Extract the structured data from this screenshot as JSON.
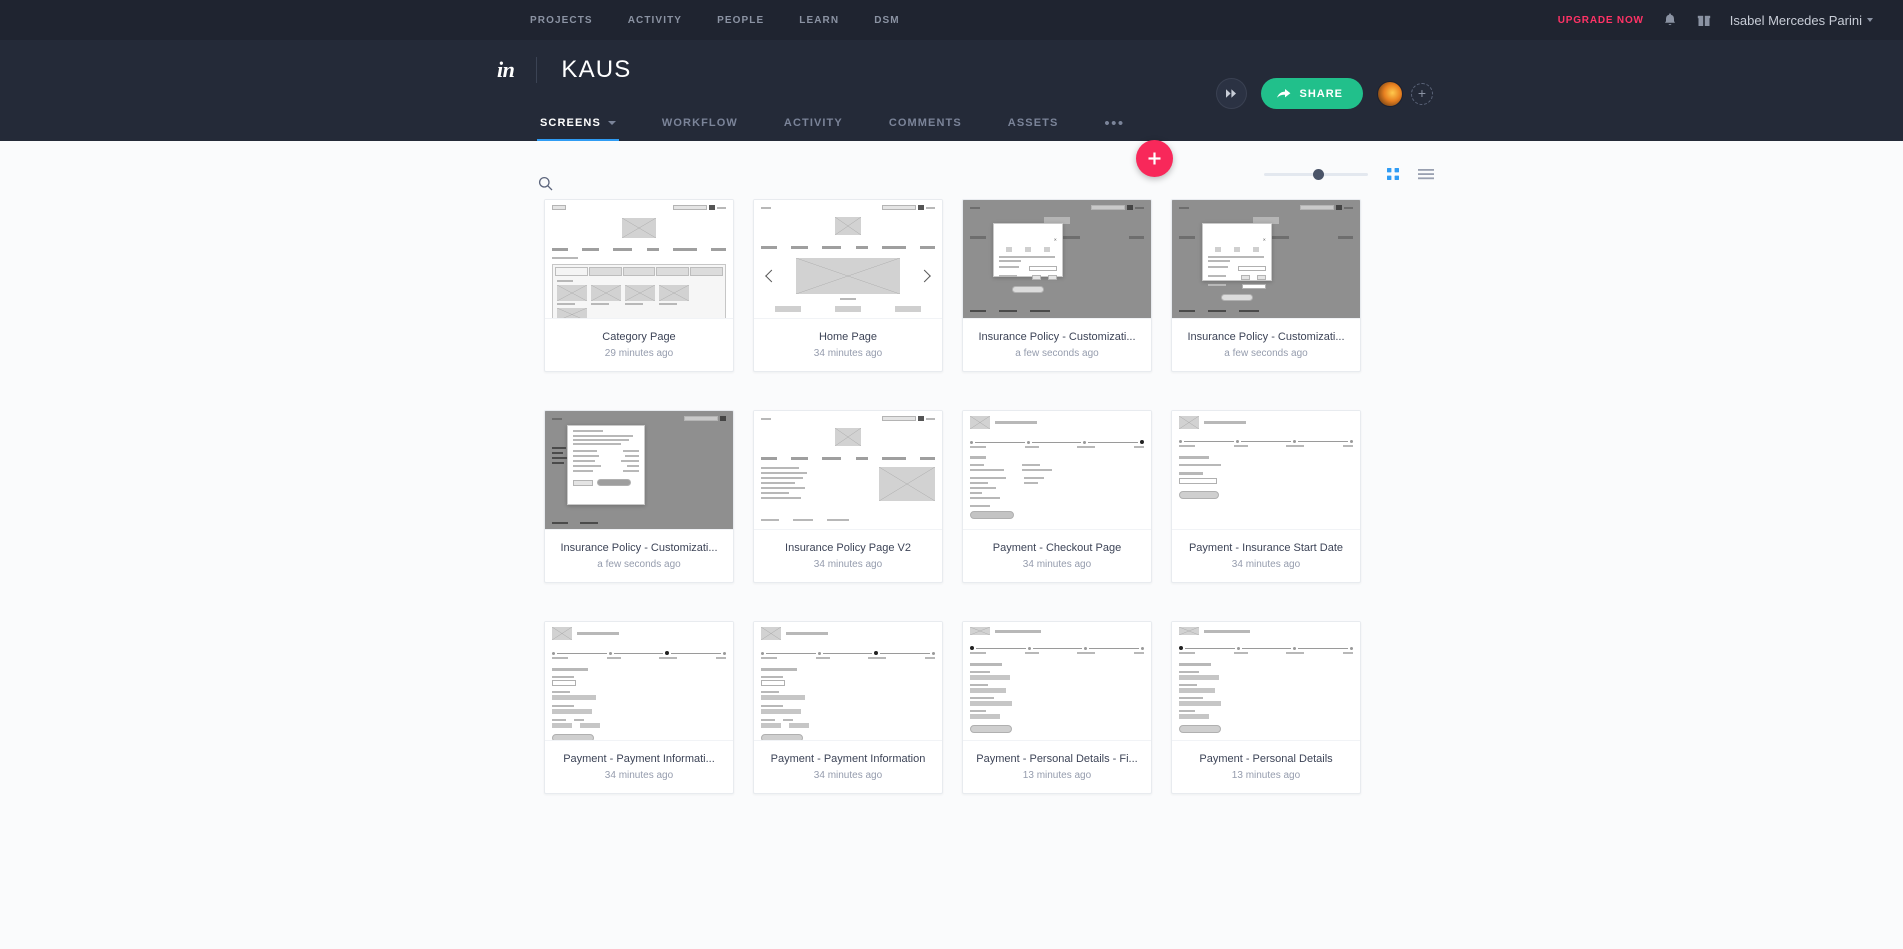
{
  "global_bar": {
    "nav": [
      {
        "label": "PROJECTS"
      },
      {
        "label": "ACTIVITY"
      },
      {
        "label": "PEOPLE"
      },
      {
        "label": "LEARN"
      },
      {
        "label": "DSM"
      }
    ],
    "upgrade_label": "UPGRADE NOW",
    "bell_icon": "bell-icon",
    "gift_icon": "gift-icon",
    "user_name": "Isabel Mercedes Parini",
    "accent_red": "#ff3366",
    "background": "#1f2430"
  },
  "project_header": {
    "logo_text": "in",
    "title": "KAUS",
    "preview_icon": "play-preview-icon",
    "share_label": "SHARE",
    "share_color": "#21c08b",
    "add_member_label": "+",
    "background": "#242a38"
  },
  "tabs": [
    {
      "label": "SCREENS",
      "active": true,
      "has_caret": true
    },
    {
      "label": "WORKFLOW",
      "active": false,
      "has_caret": false
    },
    {
      "label": "ACTIVITY",
      "active": false,
      "has_caret": false
    },
    {
      "label": "COMMENTS",
      "active": false,
      "has_caret": false
    },
    {
      "label": "ASSETS",
      "active": false,
      "has_caret": false
    }
  ],
  "tab_more_label": "•••",
  "fab": {
    "label": "+",
    "color": "#f8285a",
    "name": "add-screen-button"
  },
  "toolbar": {
    "search_placeholder": "",
    "search_value": "",
    "search_icon": "search-icon",
    "zoom_value": 47,
    "grid_view_icon": "grid-view-icon",
    "list_view_icon": "list-view-icon",
    "grid_view_active": true,
    "active_view_color": "#2f9cf4"
  },
  "screens": [
    {
      "title": "Category Page",
      "time": "29 minutes ago",
      "thumb": "category"
    },
    {
      "title": "Home Page",
      "time": "34 minutes ago",
      "thumb": "home"
    },
    {
      "title": "Insurance Policy - Customizati...",
      "time": "a few seconds ago",
      "thumb": "modal"
    },
    {
      "title": "Insurance Policy - Customizati...",
      "time": "a few seconds ago",
      "thumb": "modal2"
    },
    {
      "title": "Insurance Policy - Customizati...",
      "time": "a few seconds ago",
      "thumb": "modal3"
    },
    {
      "title": "Insurance Policy Page V2",
      "time": "34 minutes ago",
      "thumb": "policy"
    },
    {
      "title": "Payment - Checkout Page",
      "time": "34 minutes ago",
      "thumb": "checkout"
    },
    {
      "title": "Payment - Insurance Start Date",
      "time": "34 minutes ago",
      "thumb": "startdate"
    },
    {
      "title": "Payment - Payment Informati...",
      "time": "34 minutes ago",
      "thumb": "payinfo"
    },
    {
      "title": "Payment - Payment Information",
      "time": "34 minutes ago",
      "thumb": "payinfo2"
    },
    {
      "title": "Payment - Personal Details - Fi...",
      "time": "13 minutes ago",
      "thumb": "personal"
    },
    {
      "title": "Payment - Personal Details",
      "time": "13 minutes ago",
      "thumb": "personal2"
    }
  ]
}
